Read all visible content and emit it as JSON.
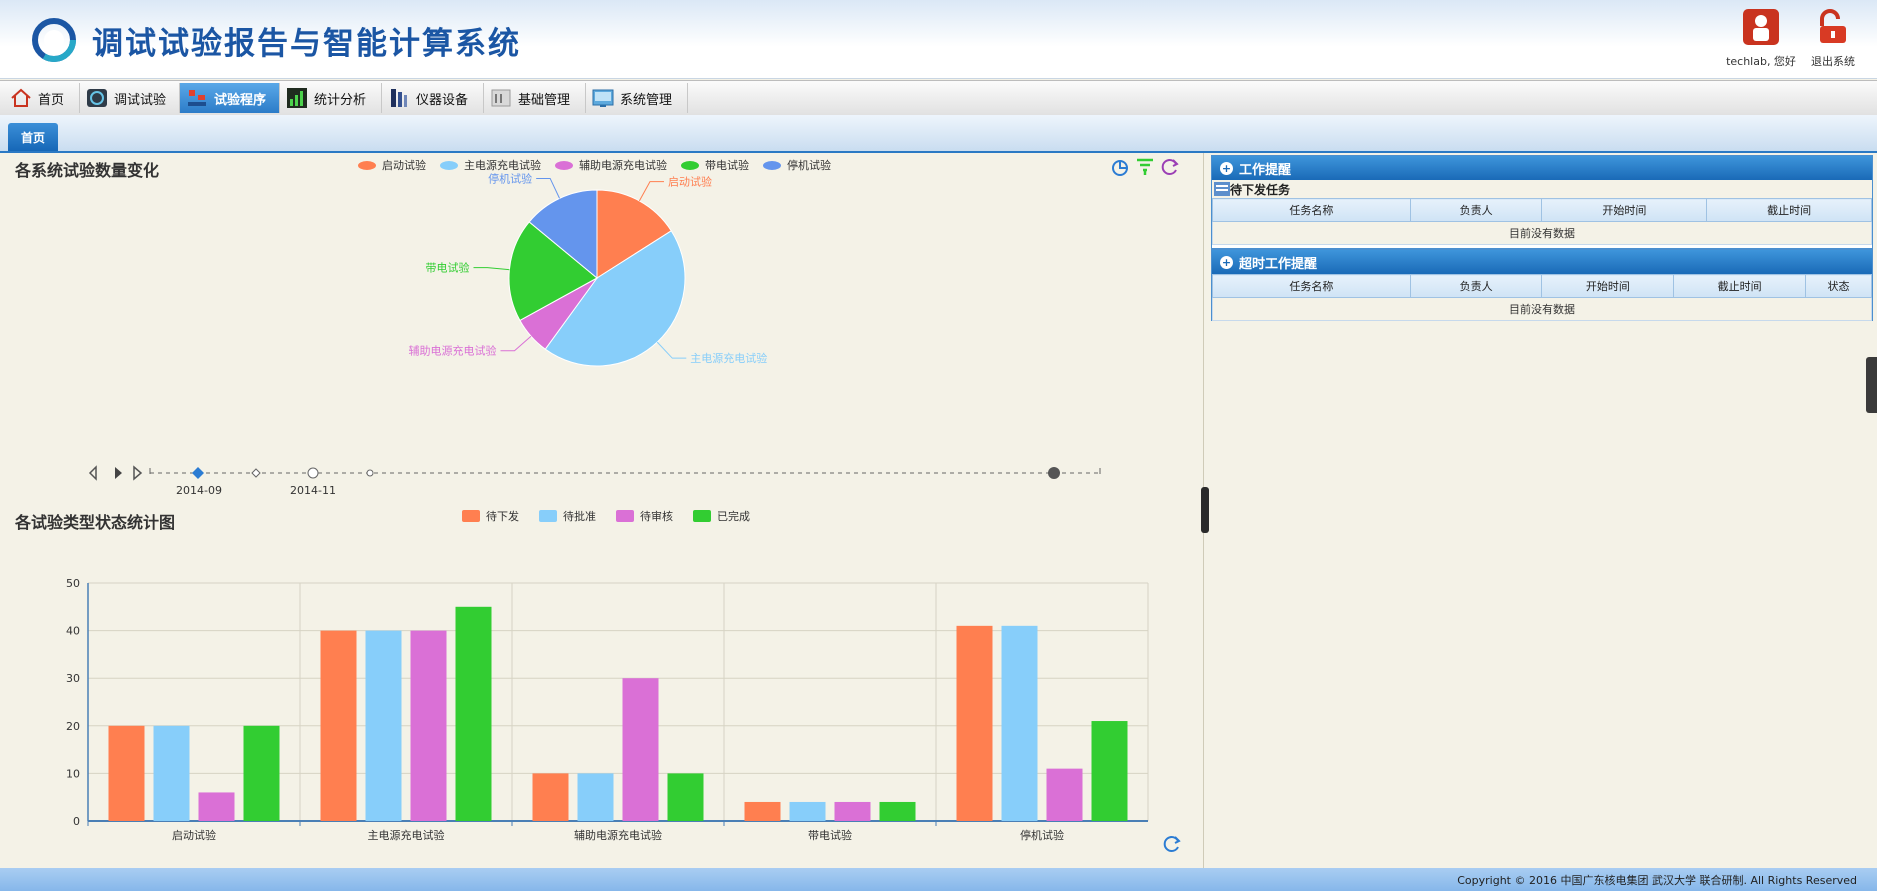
{
  "header": {
    "title": "调试试验报告与智能计算系统",
    "user_label": "techlab, 您好",
    "logout_label": "退出系统"
  },
  "menu": {
    "items": [
      {
        "label": "首页",
        "icon": "home-icon"
      },
      {
        "label": "调试试验",
        "icon": "debug-test-icon"
      },
      {
        "label": "试验程序",
        "icon": "procedure-icon",
        "active": true
      },
      {
        "label": "统计分析",
        "icon": "statistics-icon"
      },
      {
        "label": "仪器设备",
        "icon": "instrument-icon"
      },
      {
        "label": "基础管理",
        "icon": "base-management-icon"
      },
      {
        "label": "系统管理",
        "icon": "system-management-icon"
      }
    ]
  },
  "tabs": [
    {
      "label": "首页"
    }
  ],
  "pie_chart": {
    "title": "各系统试验数量变化",
    "legend": [
      "启动试验",
      "主电源充电试验",
      "辅助电源充电试验",
      "带电试验",
      "停机试验"
    ],
    "timeline_labels": [
      "2014-09",
      "2014-11"
    ]
  },
  "bar_chart": {
    "title": "各试验类型状态统计图",
    "legend": [
      "待下发",
      "待批准",
      "待审核",
      "已完成"
    ],
    "y_ticks": [
      "0",
      "10",
      "20",
      "30",
      "40",
      "50"
    ]
  },
  "chart_data": [
    {
      "type": "pie",
      "title": "各系统试验数量变化",
      "labels": [
        "启动试验",
        "主电源充电试验",
        "辅助电源充电试验",
        "带电试验",
        "停机试验"
      ],
      "values": [
        16,
        44,
        7,
        19,
        14
      ],
      "colors": [
        "#ff7f50",
        "#87cefa",
        "#da70d6",
        "#32cd32",
        "#6495ed"
      ],
      "legend_position": "top"
    },
    {
      "type": "bar",
      "title": "各试验类型状态统计图",
      "categories": [
        "启动试验",
        "主电源充电试验",
        "辅助电源充电试验",
        "带电试验",
        "停机试验"
      ],
      "series": [
        {
          "name": "待下发",
          "values": [
            20,
            40,
            10,
            4,
            41
          ],
          "color": "#ff7f50"
        },
        {
          "name": "待批准",
          "values": [
            20,
            40,
            10,
            4,
            41
          ],
          "color": "#87cefa"
        },
        {
          "name": "待审核",
          "values": [
            6,
            40,
            30,
            4,
            11
          ],
          "color": "#da70d6"
        },
        {
          "name": "已完成",
          "values": [
            20,
            45,
            10,
            4,
            21
          ],
          "color": "#32cd32"
        }
      ],
      "ylim": [
        0,
        50
      ],
      "grid": true,
      "legend_position": "top"
    }
  ],
  "work_reminder": {
    "title": "工作提醒",
    "sub_title": "待下发任务",
    "columns": [
      "任务名称",
      "负责人",
      "开始时间",
      "截止时间"
    ],
    "empty_text": "目前没有数据"
  },
  "overtime_reminder": {
    "title": "超时工作提醒",
    "columns": [
      "任务名称",
      "负责人",
      "开始时间",
      "截止时间",
      "状态"
    ],
    "empty_text": "目前没有数据"
  },
  "footer": {
    "copyright": "Copyright © 2016 中国广东核电集团 武汉大学 联合研制. All Rights Reserved"
  },
  "colors": {
    "accent": "#1a6ab7",
    "title_blue": "#1b56a4"
  }
}
